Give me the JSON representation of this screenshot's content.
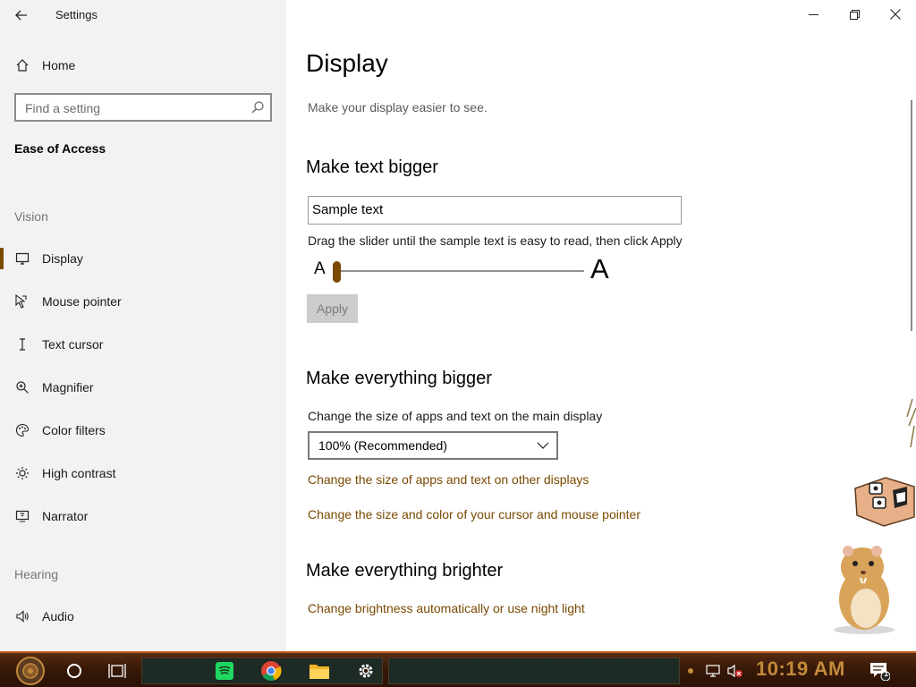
{
  "window": {
    "app_title": "Settings",
    "controls": [
      "minimize-icon",
      "restore-icon",
      "close-icon"
    ]
  },
  "sidebar": {
    "home_label": "Home",
    "search_placeholder": "Find a setting",
    "section_title": "Ease of Access",
    "groups": [
      {
        "label": "Vision",
        "items": [
          {
            "label": "Display",
            "icon": "monitor-icon",
            "active": true
          },
          {
            "label": "Mouse pointer",
            "icon": "pointer-icon"
          },
          {
            "label": "Text cursor",
            "icon": "text-cursor-icon"
          },
          {
            "label": "Magnifier",
            "icon": "magnifier-icon"
          },
          {
            "label": "Color filters",
            "icon": "palette-icon"
          },
          {
            "label": "High contrast",
            "icon": "sun-icon"
          },
          {
            "label": "Narrator",
            "icon": "narrator-icon"
          }
        ]
      },
      {
        "label": "Hearing",
        "items": [
          {
            "label": "Audio",
            "icon": "speaker-icon"
          }
        ]
      }
    ]
  },
  "main": {
    "title": "Display",
    "subtitle": "Make your display easier to see.",
    "text_bigger": {
      "heading": "Make text bigger",
      "sample_text": "Sample text",
      "hint": "Drag the slider until the sample text is easy to read, then click Apply",
      "slider_min_label": "A",
      "slider_max_label": "A",
      "slider_value_percent": 0,
      "apply_label": "Apply"
    },
    "everything_bigger": {
      "heading": "Make everything bigger",
      "description": "Change the size of apps and text on the main display",
      "scale_selected": "100% (Recommended)",
      "link_other_displays": "Change the size of apps and text on other displays",
      "link_cursor": "Change the size and color of your cursor and mouse pointer"
    },
    "everything_brighter": {
      "heading": "Make everything brighter",
      "link_brightness": "Change brightness automatically or use night light"
    }
  },
  "taskbar": {
    "clock": "10:19 AM",
    "notification_count": "1",
    "pinned_icons": [
      "cortana-icon",
      "task-view-icon",
      "spotify-icon",
      "chrome-icon",
      "file-explorer-icon",
      "settings-gear-icon"
    ]
  },
  "colors": {
    "accent": "#7a4a00",
    "sidebar_bg": "#f2f2f2",
    "taskbar_bg": "#3a1a08",
    "clock": "#c28a3a"
  }
}
